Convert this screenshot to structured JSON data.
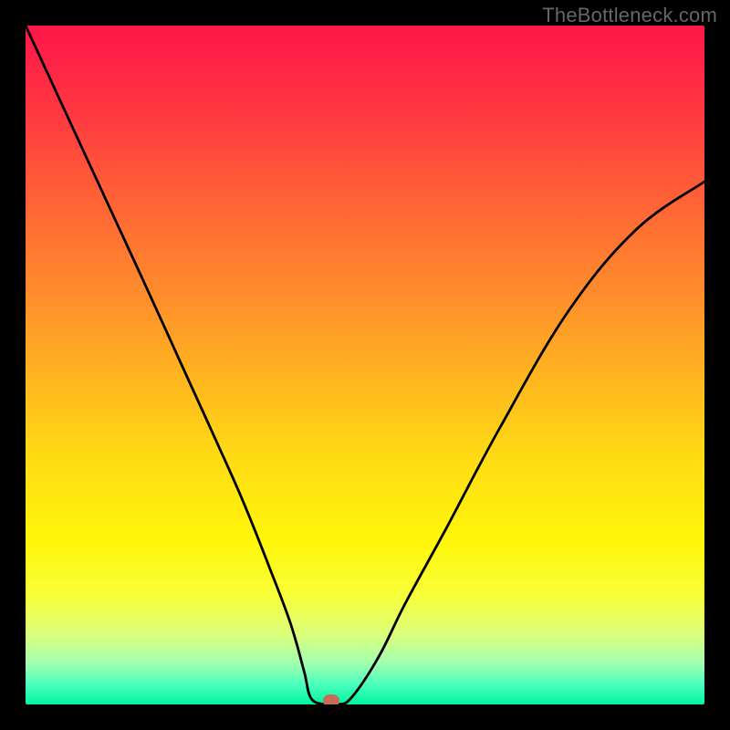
{
  "watermark": "TheBottleneck.com",
  "chart_data": {
    "type": "line",
    "title": "",
    "xlabel": "",
    "ylabel": "",
    "xlim": [
      0,
      100
    ],
    "ylim": [
      0,
      100
    ],
    "grid": false,
    "legend": false,
    "series": [
      {
        "name": "curve",
        "x": [
          0,
          6,
          12,
          18,
          23,
          28,
          32,
          36,
          39,
          41,
          42,
          44,
          46,
          48,
          52,
          56,
          62,
          70,
          80,
          90,
          100
        ],
        "values": [
          100,
          87,
          74,
          61,
          50,
          39,
          30,
          20,
          12,
          5,
          1,
          0,
          0,
          1,
          7,
          15,
          26,
          41,
          58,
          70,
          77
        ]
      }
    ],
    "markers": [
      {
        "name": "optimum",
        "x": 45,
        "y": 0,
        "color": "#c96b5a"
      }
    ],
    "background_gradient": {
      "top": "#ff1846",
      "bottom": "#00f5a0"
    }
  }
}
